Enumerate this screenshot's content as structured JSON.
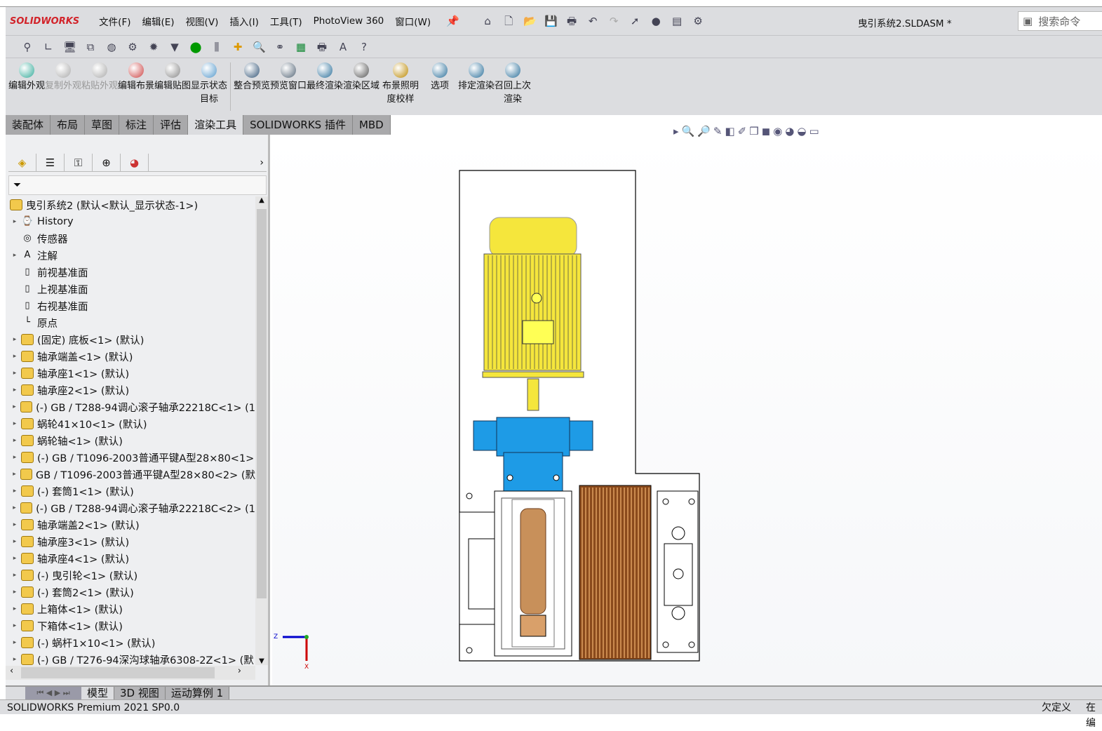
{
  "app": {
    "logo": "SOLIDWORKS",
    "document_title": "曳引系统2.SLDASM *",
    "search_placeholder": "搜索命令"
  },
  "menu": [
    "文件(F)",
    "编辑(E)",
    "视图(V)",
    "插入(I)",
    "工具(T)",
    "PhotoView 360",
    "窗口(W)"
  ],
  "command_buttons": [
    {
      "label": "编辑外观",
      "enabled": true
    },
    {
      "label": "复制外观",
      "enabled": false
    },
    {
      "label": "粘贴外观",
      "enabled": false
    },
    {
      "label": "编辑布景",
      "enabled": true
    },
    {
      "label": "编辑贴图",
      "enabled": true
    },
    {
      "label": "显示状态目标",
      "enabled": true
    },
    {
      "label": "整合预览",
      "enabled": true
    },
    {
      "label": "预览窗口",
      "enabled": true
    },
    {
      "label": "最终渲染",
      "enabled": true
    },
    {
      "label": "渲染区域",
      "enabled": true
    },
    {
      "label": "布景照明度校样",
      "enabled": true
    },
    {
      "label": "选项",
      "enabled": true
    },
    {
      "label": "排定渲染",
      "enabled": true
    },
    {
      "label": "召回上次渲染",
      "enabled": true
    }
  ],
  "tabs": [
    {
      "label": "装配体"
    },
    {
      "label": "布局"
    },
    {
      "label": "草图"
    },
    {
      "label": "标注"
    },
    {
      "label": "评估"
    },
    {
      "label": "渲染工具",
      "active": true
    },
    {
      "label": "SOLIDWORKS 插件"
    },
    {
      "label": "MBD"
    }
  ],
  "tree": {
    "root": "曳引系统2  (默认<默认_显示状态-1>)",
    "items": [
      {
        "label": "History",
        "type": "history",
        "expandable": true
      },
      {
        "label": "传感器",
        "type": "sensor",
        "expandable": false
      },
      {
        "label": "注解",
        "type": "annotation",
        "expandable": true
      },
      {
        "label": "前视基准面",
        "type": "plane",
        "expandable": false
      },
      {
        "label": "上视基准面",
        "type": "plane",
        "expandable": false
      },
      {
        "label": "右视基准面",
        "type": "plane",
        "expandable": false
      },
      {
        "label": "原点",
        "type": "origin",
        "expandable": false
      },
      {
        "label": "(固定) 底板<1> (默认)",
        "type": "part",
        "expandable": true
      },
      {
        "label": "轴承端盖<1> (默认)",
        "type": "part",
        "expandable": true
      },
      {
        "label": "轴承座1<1> (默认)",
        "type": "part",
        "expandable": true
      },
      {
        "label": "轴承座2<1> (默认)",
        "type": "part",
        "expandable": true
      },
      {
        "label": "(-) GB / T288-94调心滚子轴承22218C<1> (1",
        "type": "part",
        "expandable": true
      },
      {
        "label": "蜗轮41×10<1> (默认)",
        "type": "part",
        "expandable": true
      },
      {
        "label": "蜗轮轴<1> (默认)",
        "type": "part",
        "expandable": true
      },
      {
        "label": "(-) GB / T1096-2003普通平键A型28×80<1>",
        "type": "part",
        "expandable": true
      },
      {
        "label": "GB / T1096-2003普通平键A型28×80<2> (默",
        "type": "part",
        "expandable": true
      },
      {
        "label": "(-) 套筒1<1> (默认)",
        "type": "part",
        "expandable": true
      },
      {
        "label": "(-) GB / T288-94调心滚子轴承22218C<2> (1",
        "type": "part",
        "expandable": true
      },
      {
        "label": "轴承端盖2<1> (默认)",
        "type": "part",
        "expandable": true
      },
      {
        "label": "轴承座3<1> (默认)",
        "type": "part",
        "expandable": true
      },
      {
        "label": "轴承座4<1> (默认)",
        "type": "part",
        "expandable": true
      },
      {
        "label": "(-) 曳引轮<1> (默认)",
        "type": "part",
        "expandable": true
      },
      {
        "label": "(-) 套筒2<1> (默认)",
        "type": "part",
        "expandable": true
      },
      {
        "label": "上箱体<1> (默认)",
        "type": "part",
        "expandable": true
      },
      {
        "label": "下箱体<1> (默认)",
        "type": "part",
        "expandable": true
      },
      {
        "label": "(-) 蜗杆1×10<1> (默认)",
        "type": "part",
        "expandable": true
      },
      {
        "label": "(-) GB / T276-94深沟球轴承6308-2Z<1> (默",
        "type": "part",
        "expandable": true
      }
    ]
  },
  "bottom_tabs": [
    {
      "label": "模型",
      "active": true
    },
    {
      "label": "3D 视图"
    },
    {
      "label": "运动算例 1"
    }
  ],
  "status": {
    "product": "SOLIDWORKS Premium 2021 SP0.0",
    "state": "欠定义",
    "extra": "在编"
  },
  "triad": {
    "x": "X",
    "z": "Z"
  },
  "colors": {
    "motor": "#f5e63c",
    "gearbox": "#1e9be6",
    "worm": "#c8905a",
    "drum": "#8a4a1c",
    "logo": "#d2232a"
  }
}
